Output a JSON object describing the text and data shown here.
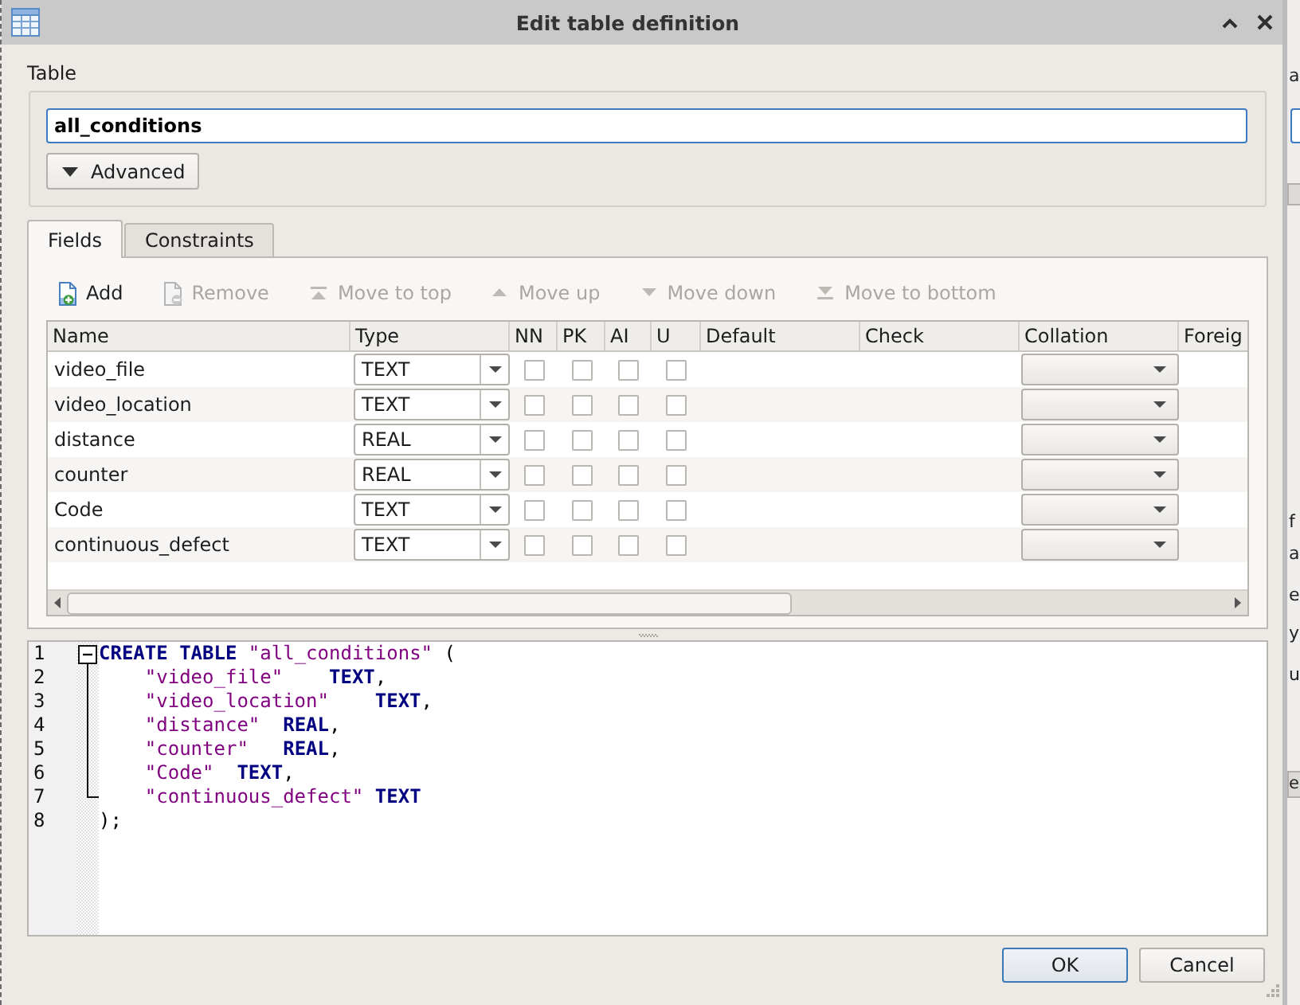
{
  "window": {
    "title": "Edit table definition"
  },
  "table_section": {
    "label": "Table",
    "name_field": {
      "value": "all_conditions"
    },
    "advanced_button": {
      "label": "Advanced",
      "expanded": false
    }
  },
  "tabs": [
    {
      "label": "Fields",
      "selected": true
    },
    {
      "label": "Constraints",
      "selected": false
    }
  ],
  "toolbar": [
    {
      "kind": "add",
      "label": "Add",
      "disabled": false
    },
    {
      "kind": "remove",
      "label": "Remove",
      "disabled": true
    },
    {
      "kind": "move_top",
      "label": "Move to top",
      "disabled": true
    },
    {
      "kind": "move_up",
      "label": "Move up",
      "disabled": true
    },
    {
      "kind": "move_down",
      "label": "Move down",
      "disabled": true
    },
    {
      "kind": "move_bottom",
      "label": "Move to bottom",
      "disabled": true
    }
  ],
  "fields_table": {
    "columns": [
      "Name",
      "Type",
      "NN",
      "PK",
      "AI",
      "U",
      "Default",
      "Check",
      "Collation",
      "Foreig"
    ],
    "rows": [
      {
        "name": "video_file",
        "type": "TEXT",
        "not_null": false,
        "primary_key": false,
        "autoincrement": false,
        "unique": false
      },
      {
        "name": "video_location",
        "type": "TEXT",
        "not_null": false,
        "primary_key": false,
        "autoincrement": false,
        "unique": false
      },
      {
        "name": "distance",
        "type": "REAL",
        "not_null": false,
        "primary_key": false,
        "autoincrement": false,
        "unique": false
      },
      {
        "name": "counter",
        "type": "REAL",
        "not_null": false,
        "primary_key": false,
        "autoincrement": false,
        "unique": false
      },
      {
        "name": "Code",
        "type": "TEXT",
        "not_null": false,
        "primary_key": false,
        "autoincrement": false,
        "unique": false
      },
      {
        "name": "continuous_defect",
        "type": "TEXT",
        "not_null": false,
        "primary_key": false,
        "autoincrement": false,
        "unique": false
      }
    ]
  },
  "sql_editor": {
    "fold_expanded": true,
    "lines": [
      {
        "number": "1",
        "indented": false,
        "tokens": [
          {
            "kind": "keyword",
            "text": "CREATE TABLE"
          },
          {
            "kind": "string",
            "text": " \"all_conditions\""
          },
          {
            "kind": "plain",
            "text": " ("
          }
        ]
      },
      {
        "number": "2",
        "indented": true,
        "tokens": [
          {
            "kind": "string",
            "text": "\"video_file\""
          },
          {
            "kind": "keyword",
            "text": "    TEXT"
          },
          {
            "kind": "plain",
            "text": ","
          }
        ]
      },
      {
        "number": "3",
        "indented": true,
        "tokens": [
          {
            "kind": "string",
            "text": "\"video_location\""
          },
          {
            "kind": "keyword",
            "text": "    TEXT"
          },
          {
            "kind": "plain",
            "text": ","
          }
        ]
      },
      {
        "number": "4",
        "indented": true,
        "tokens": [
          {
            "kind": "string",
            "text": "\"distance\""
          },
          {
            "kind": "keyword",
            "text": "  REAL"
          },
          {
            "kind": "plain",
            "text": ","
          }
        ]
      },
      {
        "number": "5",
        "indented": true,
        "tokens": [
          {
            "kind": "string",
            "text": "\"counter\""
          },
          {
            "kind": "keyword",
            "text": "   REAL"
          },
          {
            "kind": "plain",
            "text": ","
          }
        ]
      },
      {
        "number": "6",
        "indented": true,
        "tokens": [
          {
            "kind": "string",
            "text": "\"Code\""
          },
          {
            "kind": "keyword",
            "text": "  TEXT"
          },
          {
            "kind": "plain",
            "text": ","
          }
        ]
      },
      {
        "number": "7",
        "indented": true,
        "tokens": [
          {
            "kind": "string",
            "text": "\"continuous_defect\""
          },
          {
            "kind": "keyword",
            "text": " TEXT"
          }
        ]
      },
      {
        "number": "8",
        "indented": false,
        "tokens": [
          {
            "kind": "plain",
            "text": ");"
          }
        ]
      }
    ]
  },
  "buttons": [
    {
      "label": "OK",
      "default": true
    },
    {
      "label": "Cancel",
      "default": false
    }
  ],
  "background_window": {
    "items": [
      {
        "kind": "text",
        "text": "a"
      },
      {
        "kind": "field"
      },
      {
        "kind": "button"
      },
      {
        "kind": "text",
        "text": "f"
      },
      {
        "kind": "text",
        "text": "a"
      },
      {
        "kind": "text",
        "text": "e"
      },
      {
        "kind": "text",
        "text": "y"
      },
      {
        "kind": "text",
        "text": "u"
      },
      {
        "kind": "button",
        "text": "e"
      }
    ]
  }
}
